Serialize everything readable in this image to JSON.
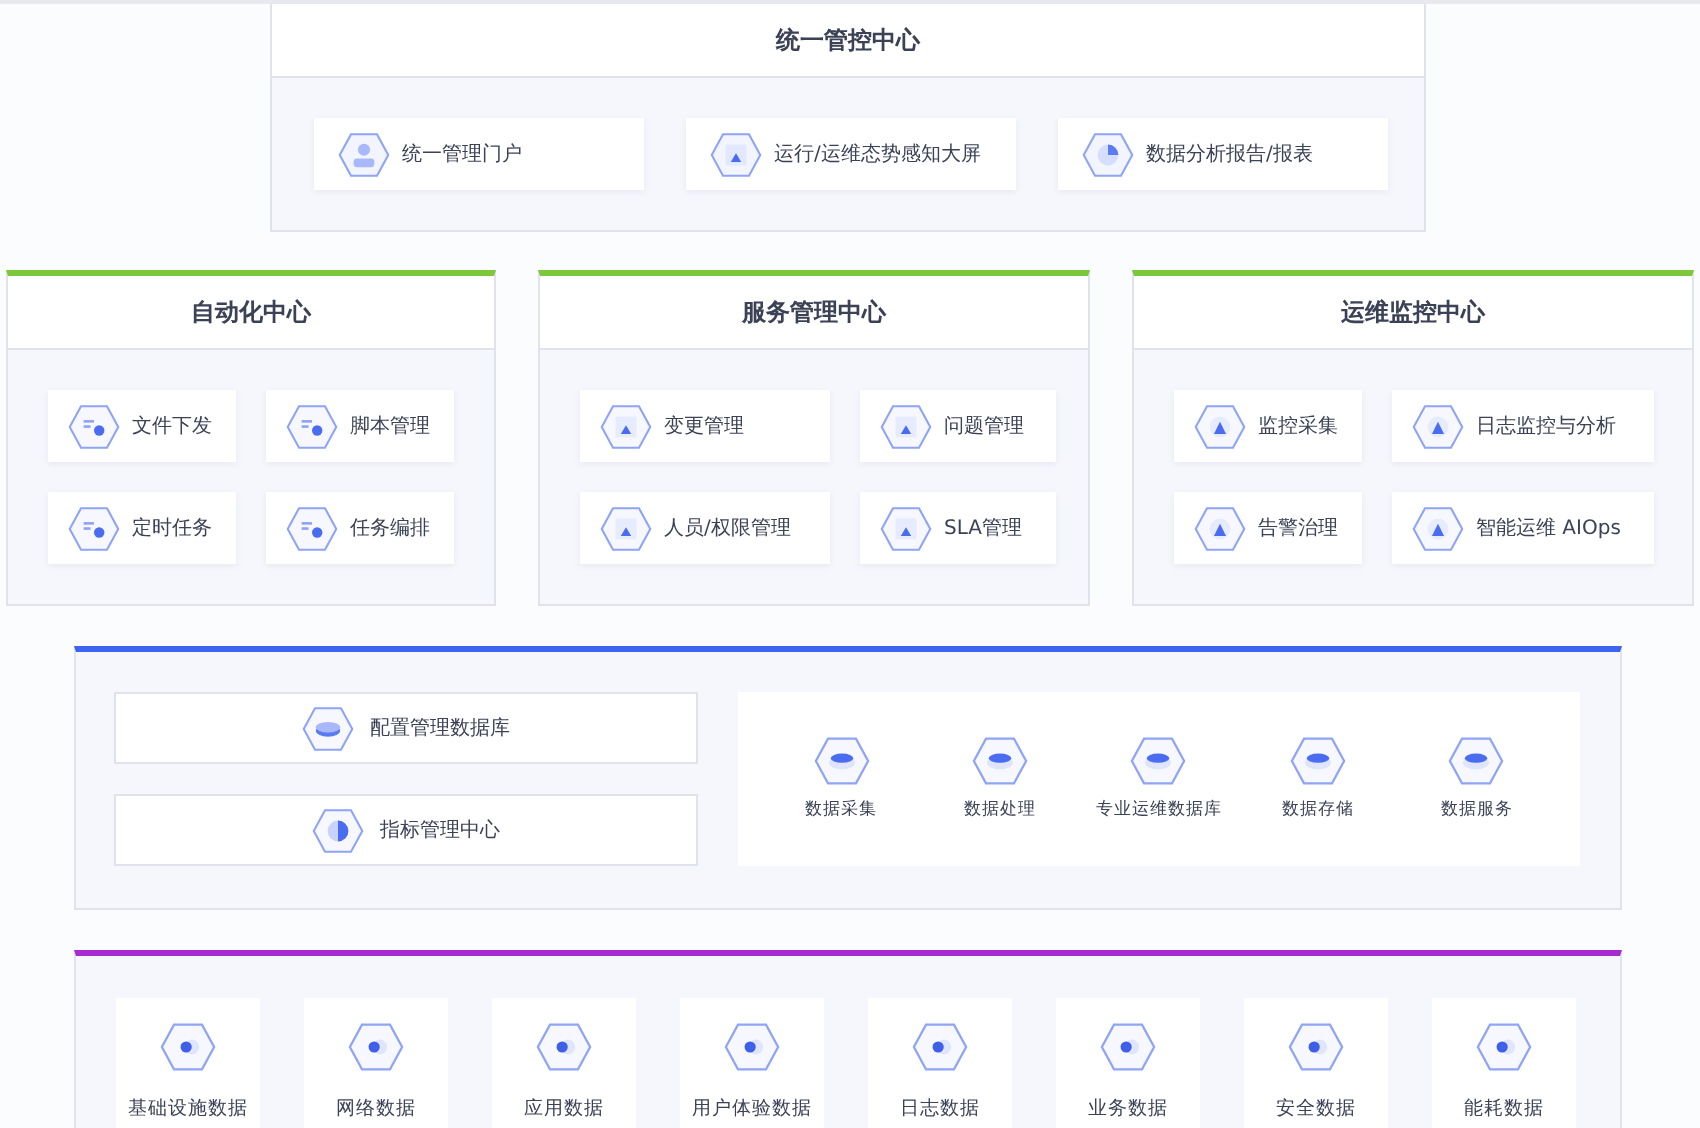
{
  "control_center": {
    "title": "统一管控中心",
    "items": [
      "统一管理门户",
      "运行/运维态势感知大屏",
      "数据分析报告/报表"
    ]
  },
  "centers": [
    {
      "title": "自动化中心",
      "items": [
        "文件下发",
        "脚本管理",
        "定时任务",
        "任务编排"
      ]
    },
    {
      "title": "服务管理中心",
      "items": [
        "变更管理",
        "问题管理",
        "人员/权限管理",
        "SLA管理"
      ]
    },
    {
      "title": "运维监控中心",
      "items": [
        "监控采集",
        "日志监控与分析",
        "告警治理",
        "智能运维 AIOps"
      ]
    }
  ],
  "data_layer": {
    "modules": [
      "配置管理数据库",
      "指标管理中心"
    ],
    "services": [
      "数据采集",
      "数据处理",
      "专业运维数据库",
      "数据存储",
      "数据服务"
    ]
  },
  "data_sources": [
    "基础设施数据",
    "网络数据",
    "应用数据",
    "用户体验数据",
    "日志数据",
    "业务数据",
    "安全数据",
    "能耗数据"
  ]
}
